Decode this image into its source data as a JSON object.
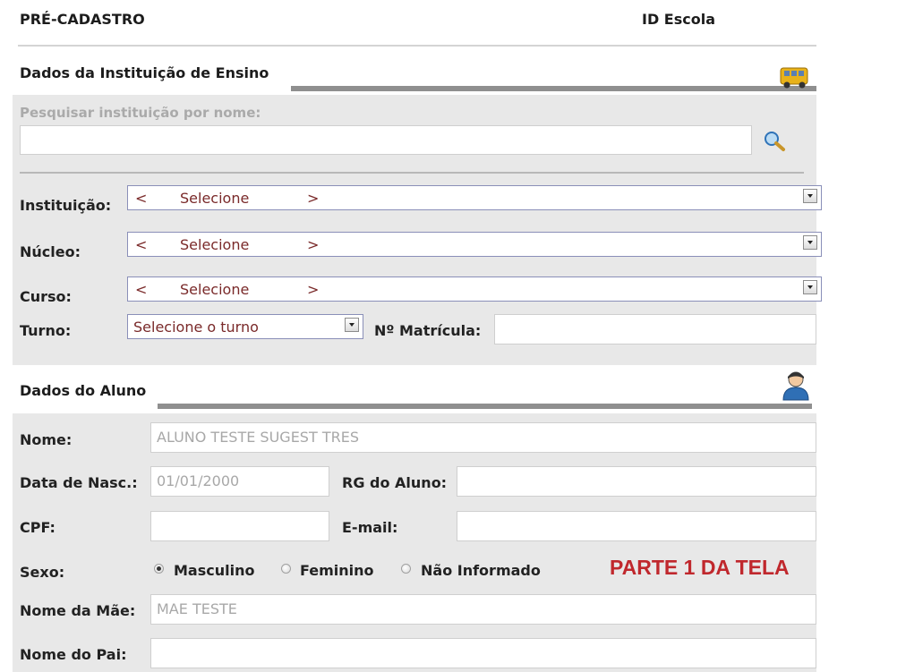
{
  "header": {
    "title": "PRÉ-CADASTRO",
    "id_escola_label": "ID Escola"
  },
  "institution_section": {
    "title": "Dados da Instituição de Ensino",
    "icon": "school-bus-icon",
    "search_label": "Pesquisar instituição por nome:",
    "search_value": "",
    "search_icon": "magnifier-icon",
    "instituicao": {
      "label": "Instituição:",
      "left": "<",
      "value": "Selecione",
      "right": ">"
    },
    "nucleo": {
      "label": "Núcleo:",
      "left": "<",
      "value": "Selecione",
      "right": ">"
    },
    "curso": {
      "label": "Curso:",
      "left": "<",
      "value": "Selecione",
      "right": ">"
    },
    "turno": {
      "label": "Turno:",
      "value": "Selecione o turno"
    },
    "matricula": {
      "label": "Nº Matrícula:",
      "value": ""
    }
  },
  "student_section": {
    "title": "Dados do Aluno",
    "icon": "user-icon",
    "nome": {
      "label": "Nome:",
      "value": "ALUNO TESTE SUGEST TRES"
    },
    "data_nasc": {
      "label": "Data de Nasc.:",
      "value": "01/01/2000"
    },
    "rg": {
      "label": "RG do Aluno:",
      "value": ""
    },
    "cpf": {
      "label": "CPF:",
      "value": ""
    },
    "email": {
      "label": "E-mail:",
      "value": ""
    },
    "sexo": {
      "label": "Sexo:",
      "options": [
        "Masculino",
        "Feminino",
        "Não Informado"
      ],
      "selected": "Masculino"
    },
    "nome_mae": {
      "label": "Nome da Mãe:",
      "value": "MAE TESTE"
    },
    "nome_pai": {
      "label": "Nome do Pai:",
      "value": ""
    }
  },
  "annotation": {
    "text": "PARTE 1 DA TELA",
    "color": "#c0282d"
  }
}
